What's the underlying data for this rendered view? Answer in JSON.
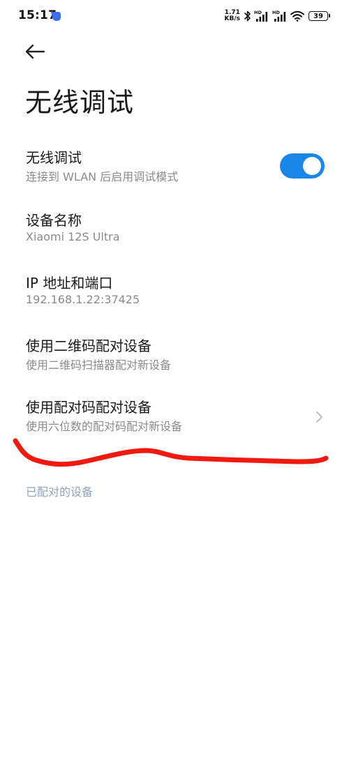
{
  "status_bar": {
    "time": "15:17",
    "net_speed_value": "1.71",
    "net_speed_unit": "KB/s",
    "battery_level": "39",
    "icons": [
      "app-notification-icon",
      "bluetooth-icon",
      "signal-hd-1-icon",
      "signal-hd-2-icon",
      "wifi-icon",
      "battery-icon"
    ]
  },
  "header": {
    "back_icon": "arrow-left-icon",
    "title": "无线调试"
  },
  "settings": {
    "wireless_debugging": {
      "title": "无线调试",
      "summary": "连接到 WLAN 后启用调试模式",
      "enabled": true
    },
    "device_name": {
      "title": "设备名称",
      "summary": "Xiaomi 12S Ultra"
    },
    "ip_port": {
      "title": "IP 地址和端口",
      "summary": "192.168.1.22:37425"
    },
    "qr_pair": {
      "title": "使用二维码配对设备",
      "summary": "使用二维码扫描器配对新设备"
    },
    "code_pair": {
      "title": "使用配对码配对设备",
      "summary": "使用六位数的配对码配对新设备",
      "chevron_icon": "chevron-right-icon"
    }
  },
  "paired_section": {
    "header": "已配对的设备"
  },
  "colors": {
    "accent": "#1a86ea",
    "annotation_stroke": "#f21a10",
    "summary_text": "#8a8a8a",
    "section_header": "#8fa3b8"
  }
}
